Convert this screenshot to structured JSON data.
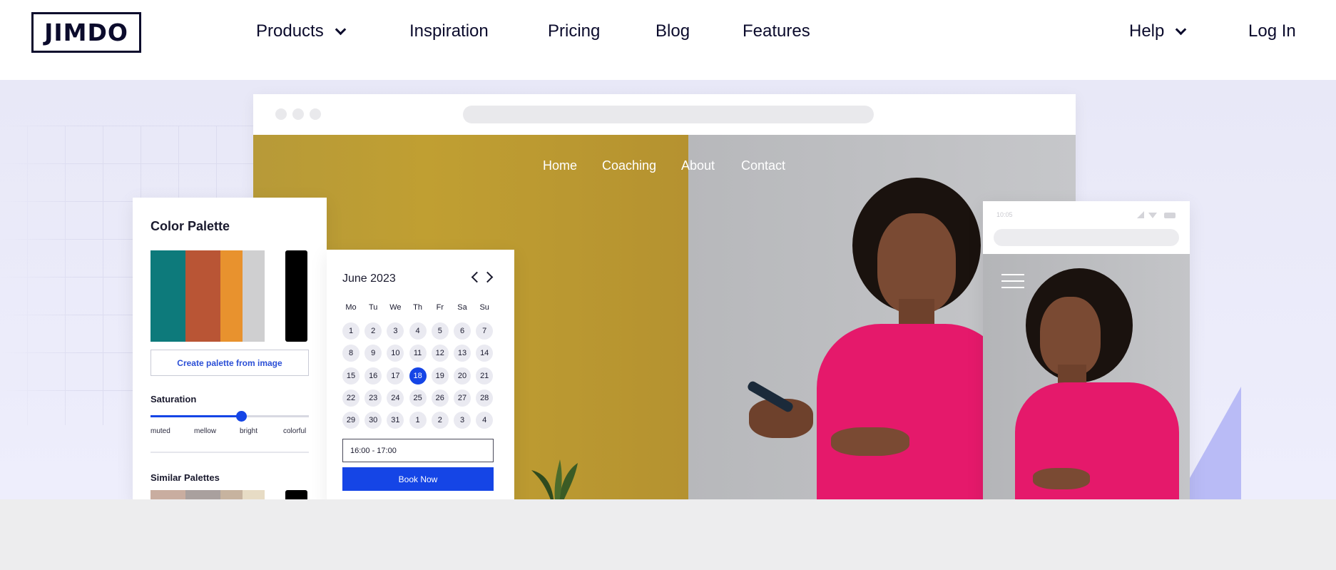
{
  "header": {
    "logo": "JIMDO",
    "nav": {
      "products": "Products",
      "inspiration": "Inspiration",
      "pricing": "Pricing",
      "blog": "Blog",
      "features": "Features",
      "help": "Help",
      "login": "Log In"
    }
  },
  "hero": {
    "site_nav": {
      "home": "Home",
      "coaching": "Coaching",
      "about": "About",
      "contact": "Contact"
    },
    "palette_card": {
      "title": "Color Palette",
      "swatches": [
        "#0d7a7b",
        "#b95535",
        "#e8922e",
        "#cfcfd0",
        "#000000"
      ],
      "create_button": "Create palette from image",
      "saturation_label": "Saturation",
      "saturation_level": 0.57,
      "ticks": [
        "muted",
        "mellow",
        "bright",
        "colorful"
      ],
      "similar_label": "Similar Palettes",
      "similar_swatches": [
        "#c9ada0",
        "#a9a09e",
        "#c7b39f",
        "#e7dcc5",
        "#000000"
      ]
    },
    "calendar_card": {
      "month": "June 2023",
      "weekdays": [
        "Mo",
        "Tu",
        "We",
        "Th",
        "Fr",
        "Sa",
        "Su"
      ],
      "weeks": [
        [
          "1",
          "2",
          "3",
          "4",
          "5",
          "6",
          "7"
        ],
        [
          "8",
          "9",
          "10",
          "11",
          "12",
          "13",
          "14"
        ],
        [
          "15",
          "16",
          "17",
          "18",
          "19",
          "20",
          "21"
        ],
        [
          "22",
          "23",
          "24",
          "25",
          "26",
          "27",
          "28"
        ],
        [
          "29",
          "30",
          "31",
          "1",
          "2",
          "3",
          "4"
        ]
      ],
      "selected_day": "18",
      "time_slot": "16:00 - 17:00",
      "book_button": "Book Now"
    },
    "mobile": {
      "status_time": "10:05"
    }
  },
  "colors": {
    "brand": "#0b0b2c",
    "accent_blue": "#1545e6",
    "hero_bg": "#e8e8f7",
    "mustard": "#c09f32",
    "shirt_pink": "#e5196b"
  }
}
